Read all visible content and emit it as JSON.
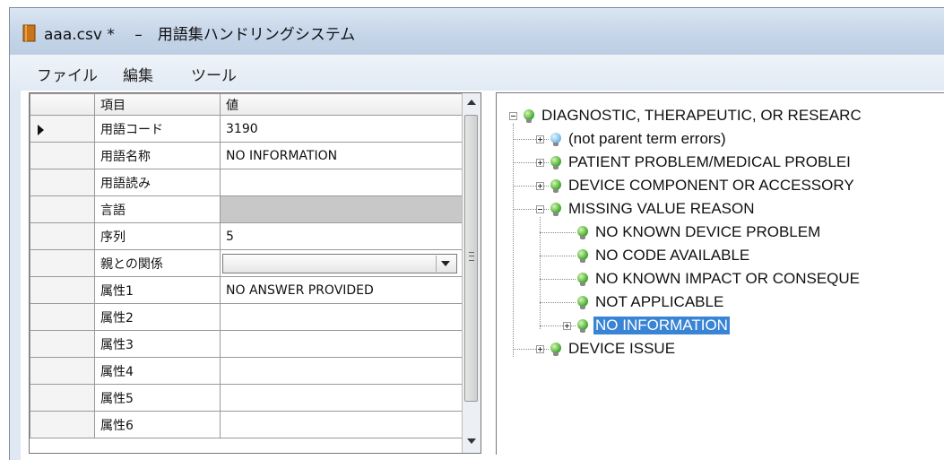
{
  "window": {
    "title": "aaa.csv * 　–　用語集ハンドリングシステム"
  },
  "menu": [
    "ファイル",
    "編集",
    "ツール"
  ],
  "grid": {
    "headers": [
      "項目",
      "値"
    ],
    "rows": [
      {
        "label": "用語コード",
        "value": "3190",
        "current": true
      },
      {
        "label": "用語名称",
        "value": "NO INFORMATION"
      },
      {
        "label": "用語読み",
        "value": ""
      },
      {
        "label": "言語",
        "value": "",
        "disabled": true
      },
      {
        "label": "序列",
        "value": "5"
      },
      {
        "label": "親との関係",
        "value": "",
        "combo": true
      },
      {
        "label": "属性1",
        "value": "NO ANSWER PROVIDED"
      },
      {
        "label": "属性2",
        "value": ""
      },
      {
        "label": "属性3",
        "value": ""
      },
      {
        "label": "属性4",
        "value": ""
      },
      {
        "label": "属性5",
        "value": ""
      },
      {
        "label": "属性6",
        "value": ""
      }
    ]
  },
  "tree": {
    "nodes": [
      {
        "label": "DIAGNOSTIC, THERAPEUTIC, OR RESEARC",
        "level": 0,
        "expander": "minus",
        "icon": "green"
      },
      {
        "label": "(not parent term errors)",
        "level": 1,
        "expander": "plus",
        "icon": "blue"
      },
      {
        "label": "PATIENT PROBLEM/MEDICAL PROBLEI",
        "level": 1,
        "expander": "plus",
        "icon": "green"
      },
      {
        "label": "DEVICE COMPONENT OR ACCESSORY",
        "level": 1,
        "expander": "plus",
        "icon": "green"
      },
      {
        "label": "MISSING VALUE REASON",
        "level": 1,
        "expander": "minus",
        "icon": "green"
      },
      {
        "label": "NO KNOWN DEVICE PROBLEM",
        "level": 2,
        "expander": "",
        "icon": "green"
      },
      {
        "label": "NO CODE AVAILABLE",
        "level": 2,
        "expander": "",
        "icon": "green"
      },
      {
        "label": "NO KNOWN IMPACT OR CONSEQUE",
        "level": 2,
        "expander": "",
        "icon": "green"
      },
      {
        "label": "NOT APPLICABLE",
        "level": 2,
        "expander": "",
        "icon": "green"
      },
      {
        "label": "NO INFORMATION",
        "level": 2,
        "expander": "plus",
        "icon": "green",
        "selected": true
      },
      {
        "label": "DEVICE ISSUE",
        "level": 1,
        "expander": "plus",
        "icon": "green"
      }
    ]
  }
}
